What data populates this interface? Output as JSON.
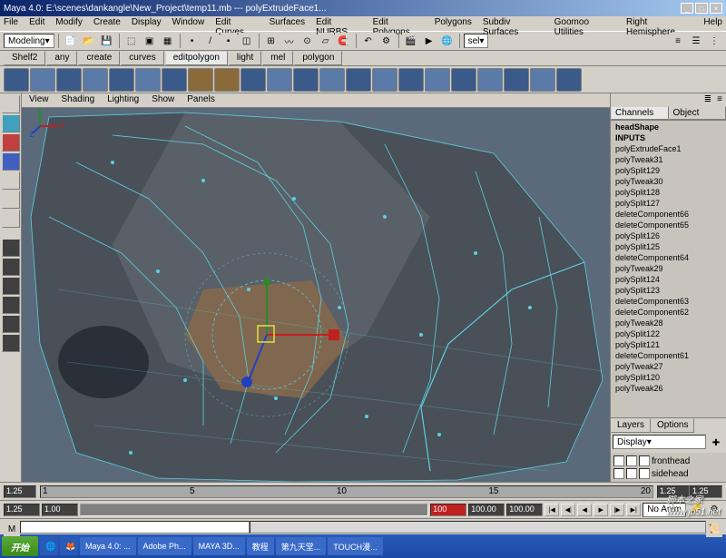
{
  "title": "Maya 4.0: E:\\scenes\\dankangle\\New_Project\\temp11.mb  ---  polyExtrudeFace1...",
  "menubar": [
    "File",
    "Edit",
    "Modify",
    "Create",
    "Display",
    "Window",
    "Edit Curves",
    "Surfaces",
    "Edit NURBS",
    "Edit Polygons",
    "Polygons",
    "Subdiv Surfaces",
    "Goomoo Utilities",
    "Right Hemisphere",
    "Help"
  ],
  "modeling_mode": "Modeling",
  "sel_label": "sel",
  "shelf_tabs": [
    "Shelf2",
    "any",
    "create",
    "curves",
    "editpolygon",
    "light",
    "mel",
    "polygon"
  ],
  "shelf_active": "editpolygon",
  "viewport_menu": [
    "View",
    "Shading",
    "Lighting",
    "Show",
    "Panels"
  ],
  "channels": {
    "tab1": "Channels",
    "tab2": "Object",
    "shape": "headShape",
    "inputs_label": "INPUTS",
    "items": [
      "polyExtrudeFace1",
      "polyTweak31",
      "polySplit129",
      "polyTweak30",
      "polySplit128",
      "polySplit127",
      "deleteComponent66",
      "deleteComponent65",
      "polySplit126",
      "polySplit125",
      "deleteComponent64",
      "polyTweak29",
      "polySplit124",
      "polySplit123",
      "deleteComponent63",
      "deleteComponent62",
      "polyTweak28",
      "polySplit122",
      "polySplit121",
      "deleteComponent61",
      "polyTweak27",
      "polySplit120",
      "polyTweak26"
    ]
  },
  "layers": {
    "tab1": "Layers",
    "tab2": "Options",
    "display_label": "Display",
    "items": [
      "fronthead",
      "sidehead"
    ]
  },
  "timeline": {
    "start_vis": "1.25",
    "end_vis": "1.25",
    "current": "1.25",
    "no_anim": "No Anim",
    "range_start": "1.00",
    "range_end": "100.00",
    "range_end2": "100.00",
    "pct": "100",
    "tick1": "1",
    "tick2": "5",
    "tick3": "10",
    "tick4": "15",
    "tick5": "20"
  },
  "taskbar": {
    "start": "开始",
    "items": [
      "Maya 4.0: ...",
      "Adobe Ph...",
      "MAYA 3D...",
      "教程",
      "第九天堂...",
      "TOUCH漫..."
    ]
  },
  "watermark": {
    "main": "脚本之家",
    "sub": "www.jb51.net"
  }
}
